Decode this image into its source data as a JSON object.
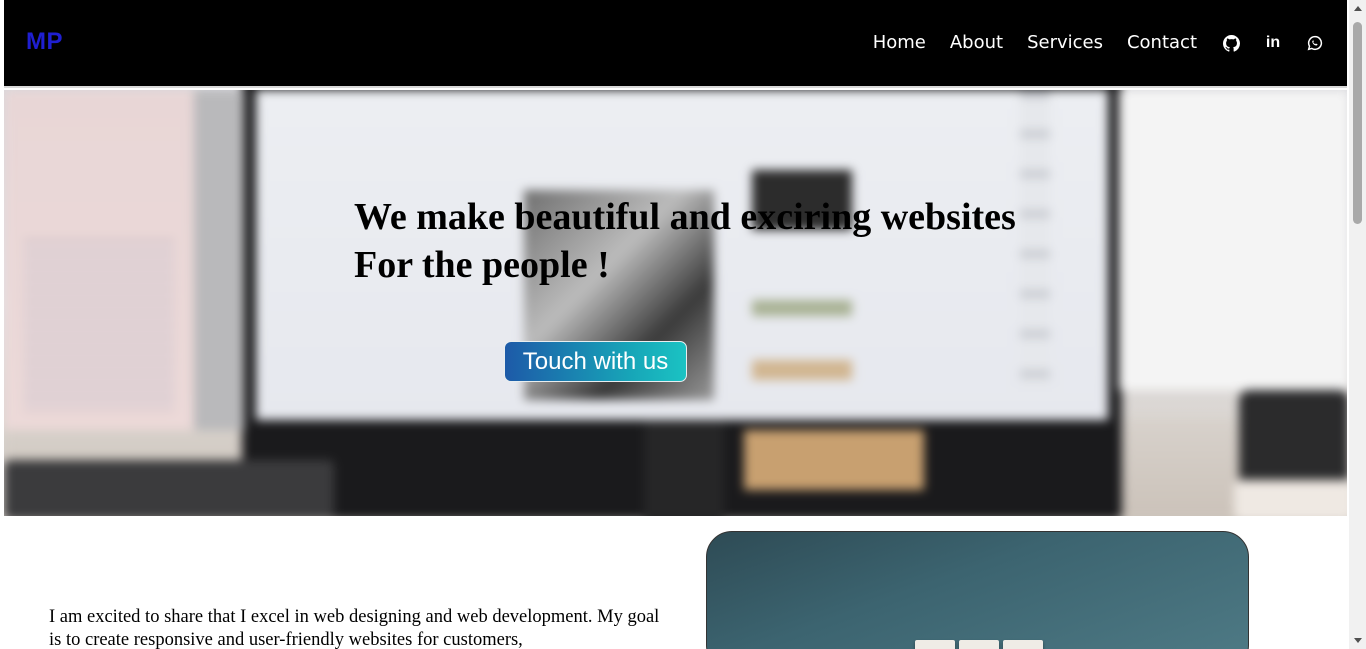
{
  "navbar": {
    "logo": "MP",
    "links": [
      "Home",
      "About",
      "Services",
      "Contact"
    ],
    "icons": [
      "github-icon",
      "linkedin-icon",
      "whatsapp-icon"
    ],
    "linkedin_glyph": "in"
  },
  "hero": {
    "title": "We make beautiful and exciring websites\nFor the people !",
    "cta_label": "Touch with us"
  },
  "about": {
    "text": "I am excited to share that I excel in web designing and web development. My goal is to create responsive and user-friendly websites for customers,"
  },
  "colors": {
    "logo": "#1f1fd1",
    "navbar_bg": "#000000",
    "cta_gradient_start": "#1d5aa8",
    "cta_gradient_end": "#1bc3c3"
  }
}
